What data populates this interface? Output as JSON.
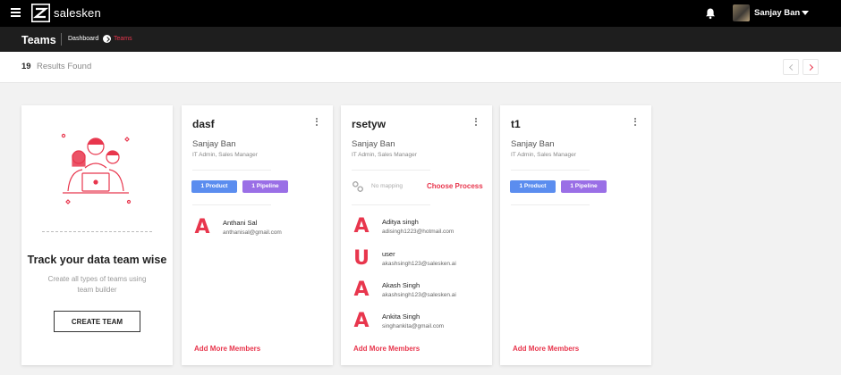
{
  "app": {
    "brand": "salesken",
    "icons": {
      "menu": "hamburger-icon",
      "logo": "salesken-logo-icon",
      "notifications": "bell-icon",
      "user_menu": "caret-down-icon"
    },
    "user_name": "Sanjay Ban"
  },
  "header": {
    "title": "Teams",
    "breadcrumb": [
      "Dashboard",
      "Teams"
    ]
  },
  "results": {
    "count": "19",
    "label": "Results Found"
  },
  "intro_card": {
    "title": "Track your data team wise",
    "description": "Create all types of teams using team builder",
    "button": "CREATE TEAM"
  },
  "teams": [
    {
      "name": "dasf",
      "manager": "Sanjay Ban",
      "role": "IT Admin, Sales Manager",
      "badges": [
        "1 Product",
        "1 Pipeline"
      ],
      "members": [
        {
          "initial": "A",
          "name": "Anthani Sal",
          "email": "anthanisal@gmail.com"
        }
      ],
      "add_members": "Add More Members"
    },
    {
      "name": "rsetyw",
      "manager": "Sanjay Ban",
      "role": "IT Admin, Sales Manager",
      "no_mapping": "No mapping",
      "choose_process": "Choose Process",
      "members": [
        {
          "initial": "A",
          "name": "Aditya singh",
          "email": "adisingh1223@hotmail.com"
        },
        {
          "initial": "U",
          "name": "user",
          "email": "akashsingh123@salesken.ai"
        },
        {
          "initial": "A",
          "name": "Akash Singh",
          "email": "akashsingh123@salesken.ai"
        },
        {
          "initial": "A",
          "name": "Ankita Singh",
          "email": "singhankita@gmail.com"
        }
      ],
      "add_members": "Add More Members"
    },
    {
      "name": "t1",
      "manager": "Sanjay Ban",
      "role": "IT Admin, Sales Manager",
      "badges": [
        "1 Product",
        "1 Pipeline"
      ],
      "members": [],
      "add_members": "Add More Members"
    }
  ],
  "colors": {
    "accent": "#e8364d",
    "product_badge": "#5b8def",
    "pipeline_badge": "#9a6fe6",
    "topbar": "#000000",
    "subbar": "#1e1e1e"
  }
}
